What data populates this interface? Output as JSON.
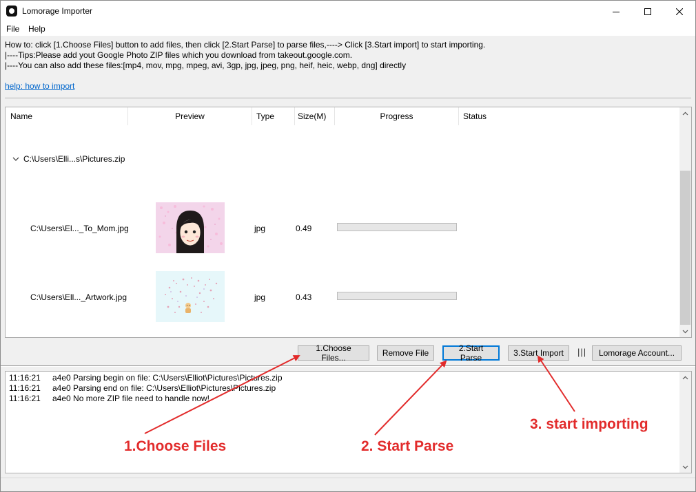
{
  "window": {
    "title": "Lomorage Importer"
  },
  "menu": {
    "file": "File",
    "help": "Help"
  },
  "instructions": {
    "line1": "How to: click [1.Choose Files] button to add files, then click [2.Start Parse] to parse files,----> Click [3.Start import] to start importing.",
    "line2": "|----Tips:Please add yout Google Photo ZIP files which you download from takeout.google.com.",
    "line3": "|----You can also add these files:[mp4, mov, mpg, mpeg, avi, 3gp, jpg, jpeg, png, heif, heic, webp, dng] directly",
    "help_link": "help: how to import"
  },
  "file_list": {
    "columns": {
      "name": "Name",
      "preview": "Preview",
      "type": "Type",
      "size": "Size(M)",
      "progress": "Progress",
      "status": "Status"
    },
    "group": {
      "label": "C:\\Users\\Elli...s\\Pictures.zip",
      "expanded": true
    },
    "rows": [
      {
        "name": "C:\\Users\\El..._To_Mom.jpg",
        "type": "jpg",
        "size": "0.49",
        "progress": 0,
        "status": ""
      },
      {
        "name": "C:\\Users\\Ell..._Artwork.jpg",
        "type": "jpg",
        "size": "0.43",
        "progress": 0,
        "status": ""
      }
    ]
  },
  "buttons": {
    "choose_files": "1.Choose Files...",
    "remove_file": "Remove File",
    "start_parse": "2.Start Parse",
    "start_import": "3.Start Import",
    "divider": "|||",
    "lomorage_account": "Lomorage Account..."
  },
  "log": [
    {
      "time": "11:16:21",
      "message": "a4e0 Parsing begin on file: C:\\Users\\Elliot\\Pictures\\Pictures.zip"
    },
    {
      "time": "11:16:21",
      "message": "a4e0 Parsing end on file: C:\\Users\\Elliot\\Pictures\\Pictures.zip"
    },
    {
      "time": "11:16:21",
      "message": "a4e0 No more ZIP file need to handle now!"
    }
  ],
  "annotations": {
    "choose": "1.Choose Files",
    "parse": "2. Start Parse",
    "import": "3. start importing"
  },
  "colors": {
    "annotation": "#e22b2b",
    "link": "#0066cc",
    "focus_border": "#0078d7"
  }
}
